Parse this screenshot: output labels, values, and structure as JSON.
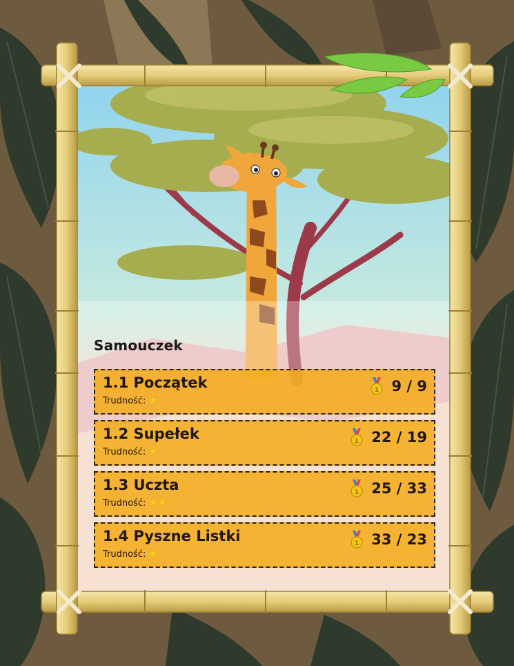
{
  "section": {
    "title": "Samouczek"
  },
  "difficulty_label": "Trudność:",
  "levels": [
    {
      "name": "1.1 Początek",
      "stars": "★",
      "score": "9 / 9"
    },
    {
      "name": "1.2 Supełek",
      "stars": "★",
      "score": "22 / 19"
    },
    {
      "name": "1.3 Uczta",
      "stars": "★★",
      "score": "25 / 33"
    },
    {
      "name": "1.4 Pyszne Listki",
      "stars": "★",
      "score": "33 / 23"
    }
  ],
  "colors": {
    "card": "#f4ac1c",
    "bamboo": "#e4cc79",
    "sky_top": "#8fd3ef",
    "leaves_dark": "#3b4a36",
    "ground_bg": "#6e5a3e"
  },
  "icons": {
    "medal": "gold-medal-icon",
    "star": "star-icon"
  }
}
